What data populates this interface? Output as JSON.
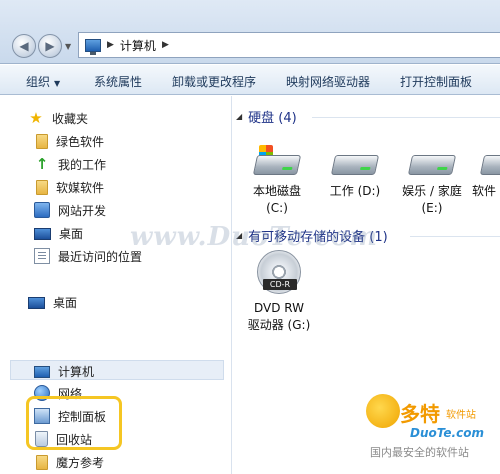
{
  "address": {
    "path": "计算机"
  },
  "toolbar": {
    "organize": "组织",
    "properties": "系统属性",
    "uninstall": "卸载或更改程序",
    "map_drive": "映射网络驱动器",
    "control_panel": "打开控制面板"
  },
  "sidebar": {
    "favorites": "收藏夹",
    "items": [
      "绿色软件",
      "我的工作",
      "软媒软件",
      "网站开发",
      "桌面",
      "最近访问的位置"
    ],
    "desktop": "桌面",
    "computer": "计算机",
    "network": "网络",
    "control_panel": "控制面板",
    "recycle_bin": "回收站",
    "mofang": "魔方参考"
  },
  "content": {
    "hdd_group": "硬盘 (4)",
    "drives": [
      {
        "line1": "本地磁盘",
        "line2": "(C:)"
      },
      {
        "line1": "工作 (D:)",
        "line2": ""
      },
      {
        "line1": "娱乐 / 家庭",
        "line2": "(E:)"
      },
      {
        "line1": "软件",
        "line2": ""
      }
    ],
    "removable_group": "有可移动存储的设备 (1)",
    "dvd": {
      "label": "CD-R",
      "line1": "DVD RW",
      "line2": "驱动器 (G:)"
    }
  },
  "watermark": "www.DuoTe.com",
  "brand": {
    "name": "多特",
    "sub": "软件站",
    "url": "DuoTe.com",
    "slogan": "国内最安全的软件站"
  },
  "colors": {
    "group_header": "#1e3287",
    "highlight": "#f5c623",
    "toolbar_text": "#1e395b"
  }
}
